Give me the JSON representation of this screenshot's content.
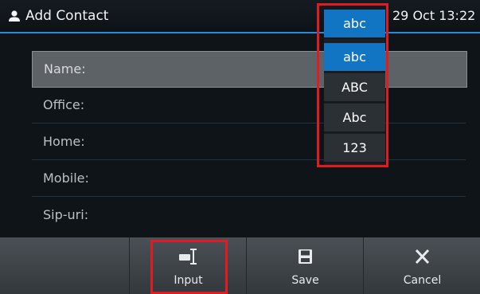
{
  "header": {
    "title": "Add Contact",
    "time": "29 Oct 13:22"
  },
  "form": {
    "fields": [
      {
        "label": "Name:"
      },
      {
        "label": "Office:"
      },
      {
        "label": "Home:"
      },
      {
        "label": "Mobile:"
      },
      {
        "label": "Sip-uri:"
      }
    ]
  },
  "input_mode": {
    "current": "abc",
    "options": [
      "abc",
      "ABC",
      "Abc",
      "123"
    ]
  },
  "softkeys": {
    "input_label": "Input",
    "save_label": "Save",
    "cancel_label": "Cancel"
  },
  "colors": {
    "accent": "#1275c4",
    "highlight": "#e11b22"
  }
}
